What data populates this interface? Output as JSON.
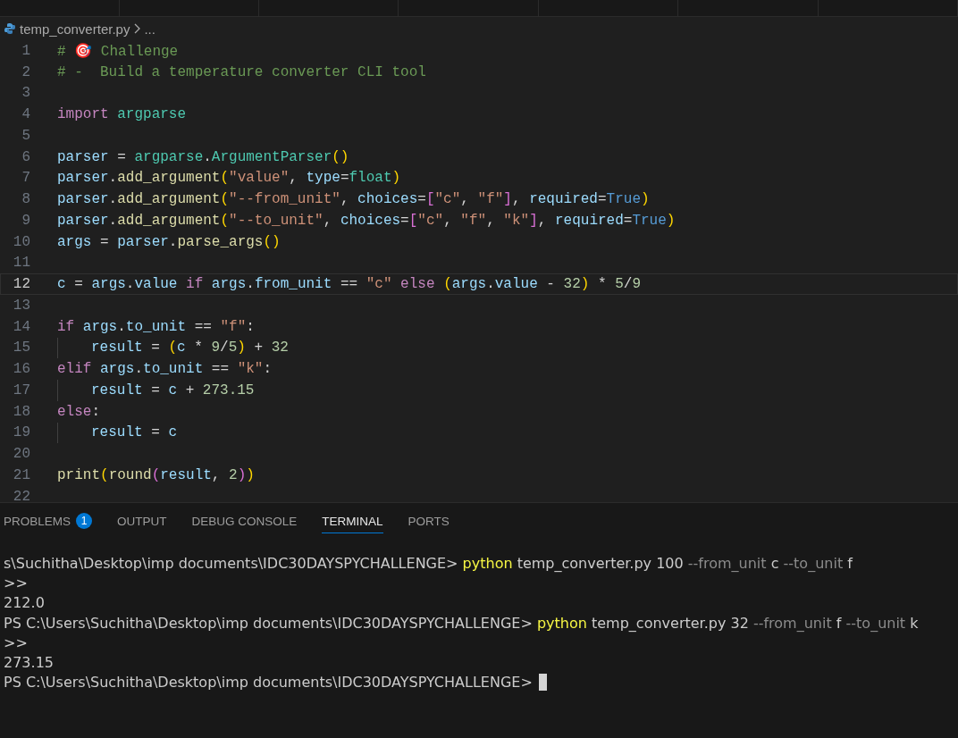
{
  "breadcrumb": {
    "file": "temp_converter.py",
    "more": "..."
  },
  "code_lines": [
    {
      "number": "1",
      "current": false,
      "indent_guide": false,
      "tokens": [
        {
          "kind": "comment",
          "text": "# 🎯 Challenge"
        }
      ]
    },
    {
      "number": "2",
      "current": false,
      "indent_guide": false,
      "tokens": [
        {
          "kind": "comment",
          "text": "# -  Build a temperature converter CLI tool"
        }
      ]
    },
    {
      "number": "3",
      "current": false,
      "indent_guide": false
    },
    {
      "number": "4",
      "current": false,
      "indent_guide": false,
      "tokens": [
        {
          "kind": "keyword",
          "text": "import "
        },
        {
          "kind": "module",
          "text": "argparse"
        }
      ]
    },
    {
      "number": "5",
      "current": false,
      "indent_guide": false
    },
    {
      "number": "6",
      "current": false,
      "indent_guide": false,
      "tokens": [
        {
          "kind": "var",
          "text": "parser"
        },
        {
          "kind": "plain",
          "text": " = "
        },
        {
          "kind": "module",
          "text": "argparse"
        },
        {
          "kind": "plain",
          "text": "."
        },
        {
          "kind": "module",
          "text": "ArgumentParser"
        },
        {
          "kind": "bracket1",
          "text": "()"
        }
      ]
    },
    {
      "number": "7",
      "current": false,
      "indent_guide": false,
      "tokens": [
        {
          "kind": "var",
          "text": "parser"
        },
        {
          "kind": "plain",
          "text": "."
        },
        {
          "kind": "func",
          "text": "add_argument"
        },
        {
          "kind": "bracket1",
          "text": "("
        },
        {
          "kind": "string",
          "text": "\"value\""
        },
        {
          "kind": "plain",
          "text": ", "
        },
        {
          "kind": "var",
          "text": "type"
        },
        {
          "kind": "plain",
          "text": "="
        },
        {
          "kind": "module",
          "text": "float"
        },
        {
          "kind": "bracket1",
          "text": ")"
        }
      ]
    },
    {
      "number": "8",
      "current": false,
      "indent_guide": false,
      "tokens": [
        {
          "kind": "var",
          "text": "parser"
        },
        {
          "kind": "plain",
          "text": "."
        },
        {
          "kind": "func",
          "text": "add_argument"
        },
        {
          "kind": "bracket1",
          "text": "("
        },
        {
          "kind": "string",
          "text": "\"--from_unit\""
        },
        {
          "kind": "plain",
          "text": ", "
        },
        {
          "kind": "var",
          "text": "choices"
        },
        {
          "kind": "plain",
          "text": "="
        },
        {
          "kind": "bracket2",
          "text": "["
        },
        {
          "kind": "string",
          "text": "\"c\""
        },
        {
          "kind": "plain",
          "text": ", "
        },
        {
          "kind": "string",
          "text": "\"f\""
        },
        {
          "kind": "bracket2",
          "text": "]"
        },
        {
          "kind": "plain",
          "text": ", "
        },
        {
          "kind": "var",
          "text": "required"
        },
        {
          "kind": "plain",
          "text": "="
        },
        {
          "kind": "const",
          "text": "True"
        },
        {
          "kind": "bracket1",
          "text": ")"
        }
      ]
    },
    {
      "number": "9",
      "current": false,
      "indent_guide": false,
      "tokens": [
        {
          "kind": "var",
          "text": "parser"
        },
        {
          "kind": "plain",
          "text": "."
        },
        {
          "kind": "func",
          "text": "add_argument"
        },
        {
          "kind": "bracket1",
          "text": "("
        },
        {
          "kind": "string",
          "text": "\"--to_unit\""
        },
        {
          "kind": "plain",
          "text": ", "
        },
        {
          "kind": "var",
          "text": "choices"
        },
        {
          "kind": "plain",
          "text": "="
        },
        {
          "kind": "bracket2",
          "text": "["
        },
        {
          "kind": "string",
          "text": "\"c\""
        },
        {
          "kind": "plain",
          "text": ", "
        },
        {
          "kind": "string",
          "text": "\"f\""
        },
        {
          "kind": "plain",
          "text": ", "
        },
        {
          "kind": "string",
          "text": "\"k\""
        },
        {
          "kind": "bracket2",
          "text": "]"
        },
        {
          "kind": "plain",
          "text": ", "
        },
        {
          "kind": "var",
          "text": "required"
        },
        {
          "kind": "plain",
          "text": "="
        },
        {
          "kind": "const",
          "text": "True"
        },
        {
          "kind": "bracket1",
          "text": ")"
        }
      ]
    },
    {
      "number": "10",
      "current": false,
      "indent_guide": false,
      "tokens": [
        {
          "kind": "var",
          "text": "args"
        },
        {
          "kind": "plain",
          "text": " = "
        },
        {
          "kind": "var",
          "text": "parser"
        },
        {
          "kind": "plain",
          "text": "."
        },
        {
          "kind": "func",
          "text": "parse_args"
        },
        {
          "kind": "bracket1",
          "text": "()"
        }
      ]
    },
    {
      "number": "11",
      "current": false,
      "indent_guide": false
    },
    {
      "number": "12",
      "current": true,
      "indent_guide": false,
      "tokens": [
        {
          "kind": "var",
          "text": "c"
        },
        {
          "kind": "plain",
          "text": " = "
        },
        {
          "kind": "var",
          "text": "args"
        },
        {
          "kind": "plain",
          "text": "."
        },
        {
          "kind": "var",
          "text": "value "
        },
        {
          "kind": "keyword",
          "text": "if "
        },
        {
          "kind": "var",
          "text": "args"
        },
        {
          "kind": "plain",
          "text": "."
        },
        {
          "kind": "var",
          "text": "from_unit"
        },
        {
          "kind": "plain",
          "text": " == "
        },
        {
          "kind": "string",
          "text": "\"c\" "
        },
        {
          "kind": "keyword",
          "text": "else "
        },
        {
          "kind": "bracket1",
          "text": "("
        },
        {
          "kind": "var",
          "text": "args"
        },
        {
          "kind": "plain",
          "text": "."
        },
        {
          "kind": "var",
          "text": "value"
        },
        {
          "kind": "plain",
          "text": " - "
        },
        {
          "kind": "number",
          "text": "32"
        },
        {
          "kind": "bracket1",
          "text": ")"
        },
        {
          "kind": "plain",
          "text": " * "
        },
        {
          "kind": "number",
          "text": "5"
        },
        {
          "kind": "plain",
          "text": "/"
        },
        {
          "kind": "number",
          "text": "9"
        }
      ]
    },
    {
      "number": "13",
      "current": false,
      "indent_guide": false
    },
    {
      "number": "14",
      "current": false,
      "indent_guide": false,
      "tokens": [
        {
          "kind": "keyword",
          "text": "if "
        },
        {
          "kind": "var",
          "text": "args"
        },
        {
          "kind": "plain",
          "text": "."
        },
        {
          "kind": "var",
          "text": "to_unit"
        },
        {
          "kind": "plain",
          "text": " == "
        },
        {
          "kind": "string",
          "text": "\"f\""
        },
        {
          "kind": "plain",
          "text": ":"
        }
      ]
    },
    {
      "number": "15",
      "current": false,
      "indent_guide": true,
      "tokens": [
        {
          "kind": "var",
          "text": "result"
        },
        {
          "kind": "plain",
          "text": " = "
        },
        {
          "kind": "bracket1",
          "text": "("
        },
        {
          "kind": "var",
          "text": "c"
        },
        {
          "kind": "plain",
          "text": " * "
        },
        {
          "kind": "number",
          "text": "9"
        },
        {
          "kind": "plain",
          "text": "/"
        },
        {
          "kind": "number",
          "text": "5"
        },
        {
          "kind": "bracket1",
          "text": ")"
        },
        {
          "kind": "plain",
          "text": " + "
        },
        {
          "kind": "number",
          "text": "32"
        }
      ]
    },
    {
      "number": "16",
      "current": false,
      "indent_guide": false,
      "tokens": [
        {
          "kind": "keyword",
          "text": "elif "
        },
        {
          "kind": "var",
          "text": "args"
        },
        {
          "kind": "plain",
          "text": "."
        },
        {
          "kind": "var",
          "text": "to_unit"
        },
        {
          "kind": "plain",
          "text": " == "
        },
        {
          "kind": "string",
          "text": "\"k\""
        },
        {
          "kind": "plain",
          "text": ":"
        }
      ]
    },
    {
      "number": "17",
      "current": false,
      "indent_guide": true,
      "tokens": [
        {
          "kind": "var",
          "text": "result"
        },
        {
          "kind": "plain",
          "text": " = "
        },
        {
          "kind": "var",
          "text": "c"
        },
        {
          "kind": "plain",
          "text": " + "
        },
        {
          "kind": "number",
          "text": "273.15"
        }
      ]
    },
    {
      "number": "18",
      "current": false,
      "indent_guide": false,
      "tokens": [
        {
          "kind": "keyword",
          "text": "else"
        },
        {
          "kind": "plain",
          "text": ":"
        }
      ]
    },
    {
      "number": "19",
      "current": false,
      "indent_guide": true,
      "tokens": [
        {
          "kind": "var",
          "text": "result"
        },
        {
          "kind": "plain",
          "text": " = "
        },
        {
          "kind": "var",
          "text": "c"
        }
      ]
    },
    {
      "number": "20",
      "current": false,
      "indent_guide": false
    },
    {
      "number": "21",
      "current": false,
      "indent_guide": false,
      "tokens": [
        {
          "kind": "func",
          "text": "print"
        },
        {
          "kind": "bracket1",
          "text": "("
        },
        {
          "kind": "func",
          "text": "round"
        },
        {
          "kind": "bracket2",
          "text": "("
        },
        {
          "kind": "var",
          "text": "result"
        },
        {
          "kind": "plain",
          "text": ", "
        },
        {
          "kind": "number",
          "text": "2"
        },
        {
          "kind": "bracket2",
          "text": ")"
        },
        {
          "kind": "bracket1",
          "text": ")"
        }
      ]
    },
    {
      "number": "22",
      "current": false,
      "indent_guide": false
    }
  ],
  "panel_tabs": [
    {
      "label": "PROBLEMS",
      "badge": "1",
      "selected": false
    },
    {
      "label": "OUTPUT",
      "selected": false
    },
    {
      "label": "DEBUG CONSOLE",
      "selected": false
    },
    {
      "label": "TERMINAL",
      "selected": true
    },
    {
      "label": "PORTS",
      "selected": false
    }
  ],
  "terminal_lines": [
    {
      "segments": [
        {
          "kind": "plain",
          "text": "s\\Suchitha\\Desktop\\imp documents\\IDC30DAYSPYCHALLENGE> "
        },
        {
          "kind": "command",
          "text": "python"
        },
        {
          "kind": "plain",
          "text": " temp_converter.py 100 "
        },
        {
          "kind": "flag",
          "text": "--from_unit"
        },
        {
          "kind": "plain",
          "text": " c "
        },
        {
          "kind": "flag",
          "text": "--to_unit"
        },
        {
          "kind": "plain",
          "text": " f"
        }
      ]
    },
    {
      "segments": [
        {
          "kind": "plain",
          "text": ">>"
        }
      ]
    },
    {
      "segments": [
        {
          "kind": "plain",
          "text": "212.0"
        }
      ]
    },
    {
      "segments": [
        {
          "kind": "plain",
          "text": "PS C:\\Users\\Suchitha\\Desktop\\imp documents\\IDC30DAYSPYCHALLENGE> "
        },
        {
          "kind": "command",
          "text": "python"
        },
        {
          "kind": "plain",
          "text": " temp_converter.py 32 "
        },
        {
          "kind": "flag",
          "text": "--from_unit"
        },
        {
          "kind": "plain",
          "text": " f "
        },
        {
          "kind": "flag",
          "text": "--to_unit"
        },
        {
          "kind": "plain",
          "text": " k"
        }
      ]
    },
    {
      "segments": [
        {
          "kind": "plain",
          "text": ">>"
        }
      ]
    },
    {
      "segments": [
        {
          "kind": "plain",
          "text": "273.15"
        }
      ]
    },
    {
      "segments": [
        {
          "kind": "plain",
          "text": "PS C:\\Users\\Suchitha\\Desktop\\imp documents\\IDC30DAYSPYCHALLENGE> "
        }
      ],
      "cursor": true
    }
  ]
}
